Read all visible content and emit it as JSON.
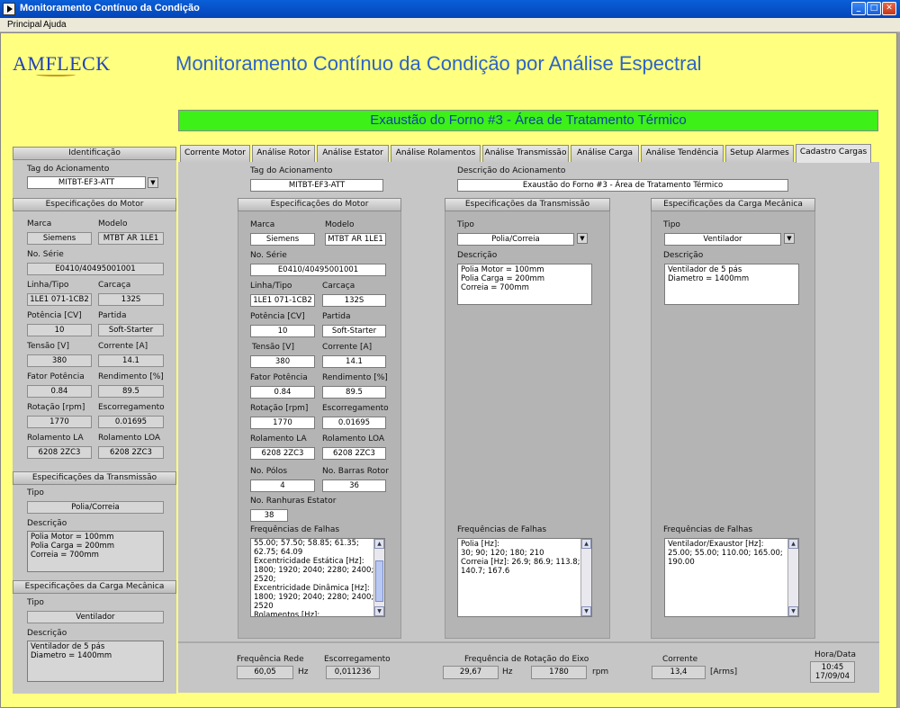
{
  "window": {
    "title": "Monitoramento Contínuo da Condição"
  },
  "menu": {
    "items": [
      "Principal",
      "Ajuda"
    ]
  },
  "header": {
    "logo": "AMFLECK",
    "title": "Monitoramento Contínuo da Condição por Análise Espectral",
    "banner": "Exaustão do Forno #3 - Área de Tratamento Térmico"
  },
  "left": {
    "identificacao": {
      "header": "Identificação",
      "tag_label": "Tag do Acionamento",
      "tag_value": "MITBT-EF3-ATT"
    },
    "motor": {
      "header": "Especificações do Motor",
      "marca_label": "Marca",
      "marca": "Siemens",
      "modelo_label": "Modelo",
      "modelo": "MTBT AR 1LE1",
      "serie_label": "No. Série",
      "serie": "E0410/40495001001",
      "linha_label": "Linha/Tipo",
      "linha": "1LE1 071-1CB2",
      "carcaca_label": "Carcaça",
      "carcaca": "132S",
      "potencia_label": "Potência [CV]",
      "potencia": "10",
      "partida_label": "Partida",
      "partida": "Soft-Starter",
      "tensao_label": "Tensão [V]",
      "tensao": "380",
      "corrente_label": "Corrente [A]",
      "corrente": "14.1",
      "fator_label": "Fator Potência",
      "fator": "0.84",
      "rend_label": "Rendimento [%]",
      "rend": "89.5",
      "rotacao_label": "Rotação [rpm]",
      "rotacao": "1770",
      "escorr_label": "Escorregamento",
      "escorr": "0.01695",
      "rla_label": "Rolamento LA",
      "rla": "6208 2ZC3",
      "rloa_label": "Rolamento LOA",
      "rloa": "6208 2ZC3"
    },
    "transmissao": {
      "header": "Especificações da Transmissão",
      "tipo_label": "Tipo",
      "tipo": "Polia/Correia",
      "desc_label": "Descrição",
      "desc": "Polia Motor = 100mm\nPolia Carga = 200mm\nCorreia = 700mm"
    },
    "carga": {
      "header": "Especificações da Carga Mecânica",
      "tipo_label": "Tipo",
      "tipo": "Ventilador",
      "desc_label": "Descrição",
      "desc": "Ventilador de 5 pás\nDiametro = 1400mm"
    }
  },
  "tabs": [
    "Corrente Motor",
    "Análise Rotor",
    "Análise Estator",
    "Análise Rolamentos",
    "Análise Transmissão",
    "Análise Carga",
    "Análise Tendência",
    "Setup Alarmes",
    "Cadastro Cargas"
  ],
  "cadastro": {
    "tag_label": "Tag do Acionamento",
    "tag": "MITBT-EF3-ATT",
    "desc_label": "Descrição do Acionamento",
    "desc": "Exaustão do Forno #3 - Área de Tratamento Térmico",
    "motor": {
      "header": "Especificações do Motor",
      "marca_label": "Marca",
      "marca": "Siemens",
      "modelo_label": "Modelo",
      "modelo": "MTBT AR 1LE1",
      "serie_label": "No. Série",
      "serie": "E0410/40495001001",
      "linha_label": "Linha/Tipo",
      "linha": "1LE1 071-1CB2",
      "carcaca_label": "Carcaça",
      "carcaca": "132S",
      "potencia_label": "Potência [CV]",
      "potencia": "10",
      "partida_label": "Partida",
      "partida": "Soft-Starter",
      "tensao_label": "Tensão [V]",
      "tensao": "380",
      "corrente_label": "Corrente [A]",
      "corrente": "14.1",
      "fator_label": "Fator Potência",
      "fator": "0.84",
      "rend_label": "Rendimento [%]",
      "rend": "89.5",
      "rotacao_label": "Rotação [rpm]",
      "rotacao": "1770",
      "escorr_label": "Escorregamento",
      "escorr": "0.01695",
      "rla_label": "Rolamento LA",
      "rla": "6208 2ZC3",
      "rloa_label": "Rolamento LOA",
      "rloa": "6208 2ZC3",
      "polos_label": "No. Pólos",
      "polos": "4",
      "barras_label": "No. Barras Rotor",
      "barras": "36",
      "ranhuras_label": "No. Ranhuras Estator",
      "ranhuras": "38",
      "freq_label": "Frequências de Falhas",
      "freq": "55.00; 57.50; 58.85; 61.35;\n62.75; 64.09\nExcentricidade Estática [Hz]:\n1800; 1920; 2040; 2280; 2400;\n2520;\nExcentricidade Dinâmica [Hz]:\n1800; 1920; 2040; 2280; 2400;\n2520\nRolamentos [Hz]:"
    },
    "transmissao": {
      "header": "Especificações da Transmissão",
      "tipo_label": "Tipo",
      "tipo": "Polia/Correia",
      "desc_label": "Descrição",
      "desc": "Polia Motor = 100mm\nPolia Carga = 200mm\nCorreia = 700mm",
      "freq_label": "Frequências de Falhas",
      "freq": "Polia [Hz]:\n30; 90; 120; 180; 210\nCorreia [Hz]: 26.9; 86.9; 113.8;\n140.7; 167.6"
    },
    "carga": {
      "header": "Especificações da Carga Mecânica",
      "tipo_label": "Tipo",
      "tipo": "Ventilador",
      "desc_label": "Descrição",
      "desc": "Ventilador de 5 pás\nDiametro = 1400mm",
      "freq_label": "Frequências de Falhas",
      "freq": "Ventilador/Exaustor [Hz]:\n25.00; 55.00; 110.00; 165.00;\n190.00"
    }
  },
  "bottom": {
    "freq_rede_label": "Frequência Rede",
    "freq_rede": "60,05",
    "hz1": "Hz",
    "escorr_label": "Escorregamento",
    "escorr": "0,011236",
    "rot_eixo_label": "Frequência de Rotação do Eixo",
    "rot_hz": "29,67",
    "hz2": "Hz",
    "rot_rpm": "1780",
    "rpm": "rpm",
    "corrente_label": "Corrente",
    "corrente": "13,4",
    "arms": "[Arms]",
    "hora_label": "Hora/Data",
    "hora": "10:45",
    "data": "17/09/04"
  }
}
